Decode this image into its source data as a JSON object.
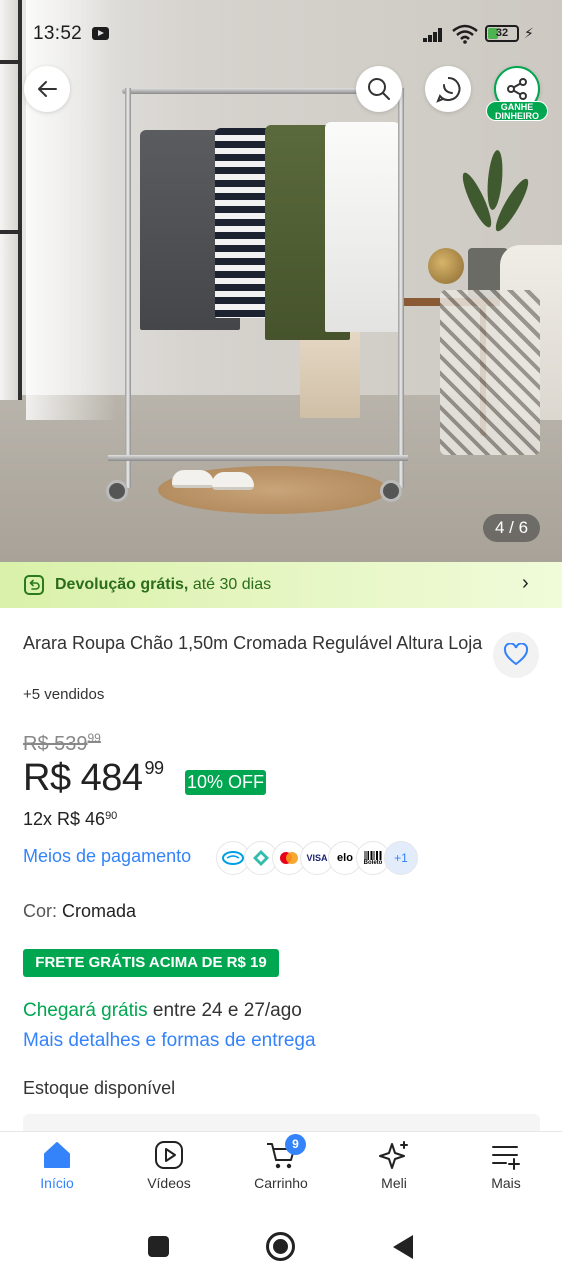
{
  "status_bar": {
    "time": "13:52",
    "battery": "32"
  },
  "hero": {
    "counter": "4 / 6",
    "earn_badge": "GANHE DINHEIRO"
  },
  "return_banner": {
    "bold": "Devolução grátis,",
    "rest": " até 30 dias"
  },
  "product": {
    "title": "Arara Roupa Chão 1,50m Cromada Regulável Altura Loja",
    "sold": "+5 vendidos",
    "old_price": "R$ 539",
    "old_price_cents": "99",
    "price": "R$ 484",
    "price_cents": "99",
    "discount": "10% OFF",
    "installments": "12x R$ 46",
    "installments_cents": "90"
  },
  "payment": {
    "link": "Meios de pagamento",
    "icons": [
      "mercado-pago-icon",
      "pix-icon",
      "mastercard-icon",
      "visa-icon",
      "elo-icon",
      "boleto-icon"
    ],
    "visa": "VISA",
    "elo": "elo",
    "boleto": "Boleto",
    "more": "+1"
  },
  "color": {
    "label": "Cor: ",
    "value": "Cromada"
  },
  "shipping": {
    "badge": "FRETE GRÁTIS ACIMA DE R$ 19",
    "arrival_green": "Chegará grátis",
    "arrival_rest": " entre 24 e 27/ago",
    "details_link": "Mais detalhes e formas de entrega"
  },
  "stock": {
    "label": "Estoque disponível"
  },
  "bottom_nav": {
    "items": [
      {
        "label": "Início",
        "icon": "home-icon",
        "active": true
      },
      {
        "label": "Vídeos",
        "icon": "play-icon"
      },
      {
        "label": "Carrinho",
        "icon": "cart-icon",
        "badge": "9"
      },
      {
        "label": "Meli",
        "icon": "sparkle-icon"
      },
      {
        "label": "Mais",
        "icon": "menu-plus-icon"
      }
    ]
  },
  "colors": {
    "accent_blue": "#3483fa",
    "green": "#00a650",
    "banner_green": "#d9f1a9"
  }
}
